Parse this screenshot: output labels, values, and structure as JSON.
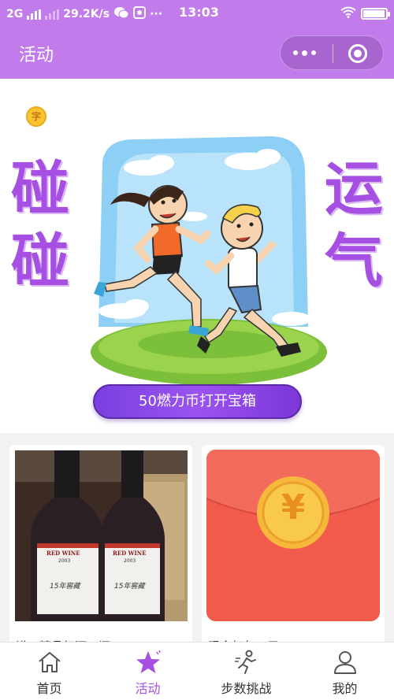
{
  "status_bar": {
    "network": "2G",
    "speed": "29.2K/s",
    "time": "13:03",
    "more": "···",
    "battery_level": 0.95
  },
  "nav": {
    "title": "活动"
  },
  "banner": {
    "left_chars": [
      "碰",
      "碰"
    ],
    "right_chars": [
      "运",
      "气"
    ],
    "coin_badge": "字",
    "button_label": "50燃力币打开宝箱"
  },
  "cards": [
    {
      "caption": "进口精品红酒一瓶",
      "image_labels": [
        "RED WINE",
        "2003",
        "15年窖藏"
      ]
    },
    {
      "caption": "现金红包一元",
      "symbol": "¥"
    }
  ],
  "tabs": [
    {
      "label": "首页",
      "icon": "home-icon",
      "active": false
    },
    {
      "label": "活动",
      "icon": "star-icon",
      "active": true
    },
    {
      "label": "步数挑战",
      "icon": "runner-icon",
      "active": false
    },
    {
      "label": "我的",
      "icon": "user-icon",
      "active": false
    }
  ],
  "colors": {
    "brand_purple": "#c27bea",
    "accent_purple": "#a64fe3",
    "button_purple": "#7a3fe0",
    "red_packet": "#f25a4c",
    "coin_gold": "#f7c531"
  }
}
